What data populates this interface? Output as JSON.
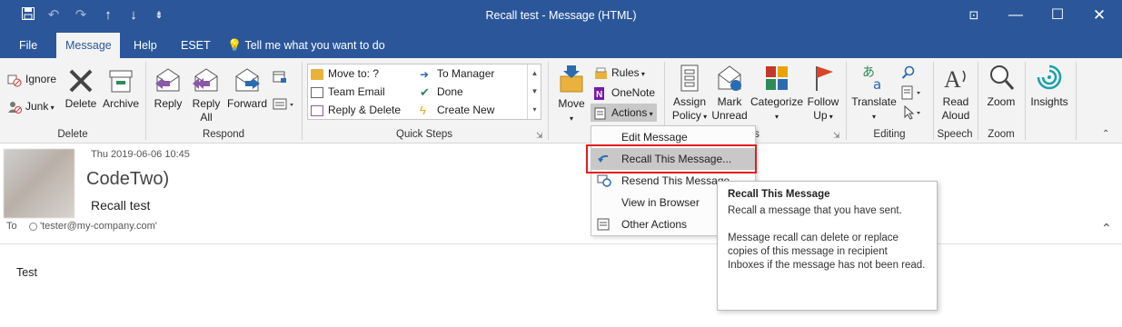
{
  "window": {
    "title": "Recall test  -  Message (HTML)",
    "controls": [
      "restore-ribbon",
      "minimize",
      "maximize",
      "close"
    ]
  },
  "qat": {
    "icons": [
      "save-icon",
      "undo-icon",
      "redo-icon",
      "up-arrow-icon",
      "down-arrow-icon",
      "customize-icon"
    ]
  },
  "tabs": [
    {
      "label": "File",
      "active": false
    },
    {
      "label": "Message",
      "active": true
    },
    {
      "label": "Help",
      "active": false
    },
    {
      "label": "ESET",
      "active": false
    }
  ],
  "tell_me": "Tell me what you want to do",
  "ribbon": {
    "delete_group": {
      "label": "Delete",
      "ignore": "Ignore",
      "junk": "Junk",
      "delete": "Delete",
      "archive": "Archive"
    },
    "respond_group": {
      "label": "Respond",
      "reply": "Reply",
      "reply_all_1": "Reply",
      "reply_all_2": "All",
      "forward": "Forward"
    },
    "quick_steps": {
      "label": "Quick Steps",
      "items": [
        "Move to: ?",
        "Team Email",
        "Reply & Delete",
        "To Manager",
        "Done",
        "Create New"
      ]
    },
    "move_group": {
      "move": "Move",
      "rules": "Rules",
      "onenote": "OneNote",
      "actions": "Actions"
    },
    "tags_group": {
      "assign_policy_1": "Assign",
      "assign_policy_2": "Policy",
      "mark_unread_1": "Mark",
      "mark_unread_2": "Unread",
      "categorize": "Categorize",
      "follow_up_1": "Follow",
      "follow_up_2": "Up",
      "label_tail": "s"
    },
    "editing_group": {
      "label": "Editing",
      "translate": "Translate"
    },
    "speech_group": {
      "label": "Speech",
      "read_aloud_1": "Read",
      "read_aloud_2": "Aloud"
    },
    "zoom_group": {
      "label": "Zoom",
      "zoom": "Zoom"
    },
    "insights": "Insights"
  },
  "message": {
    "date": "Thu 2019-06-06 10:45",
    "sender": "CodeTwo)",
    "subject": "Recall test",
    "to_label": "To",
    "to_value": "'tester@my-company.com'",
    "body": "Test"
  },
  "actions_menu": {
    "items": [
      {
        "label": "Edit Message",
        "icon": "edit-message-icon",
        "highlight": false
      },
      {
        "label": "Recall This Message...",
        "icon": "recall-icon",
        "highlight": true
      },
      {
        "label": "Resend This Message",
        "icon": "resend-icon",
        "highlight": false
      },
      {
        "label": "View in Browser",
        "icon": "",
        "highlight": false
      },
      {
        "label": "Other Actions",
        "icon": "other-actions-icon",
        "highlight": false
      }
    ]
  },
  "tooltip": {
    "title": "Recall This Message",
    "line1": "Recall a message that you have sent.",
    "line2": "Message recall can delete or replace copies of this message in recipient Inboxes if the message has not been read."
  },
  "colors": {
    "accent": "#2b579a",
    "highlight_border": "#e31d1d"
  }
}
